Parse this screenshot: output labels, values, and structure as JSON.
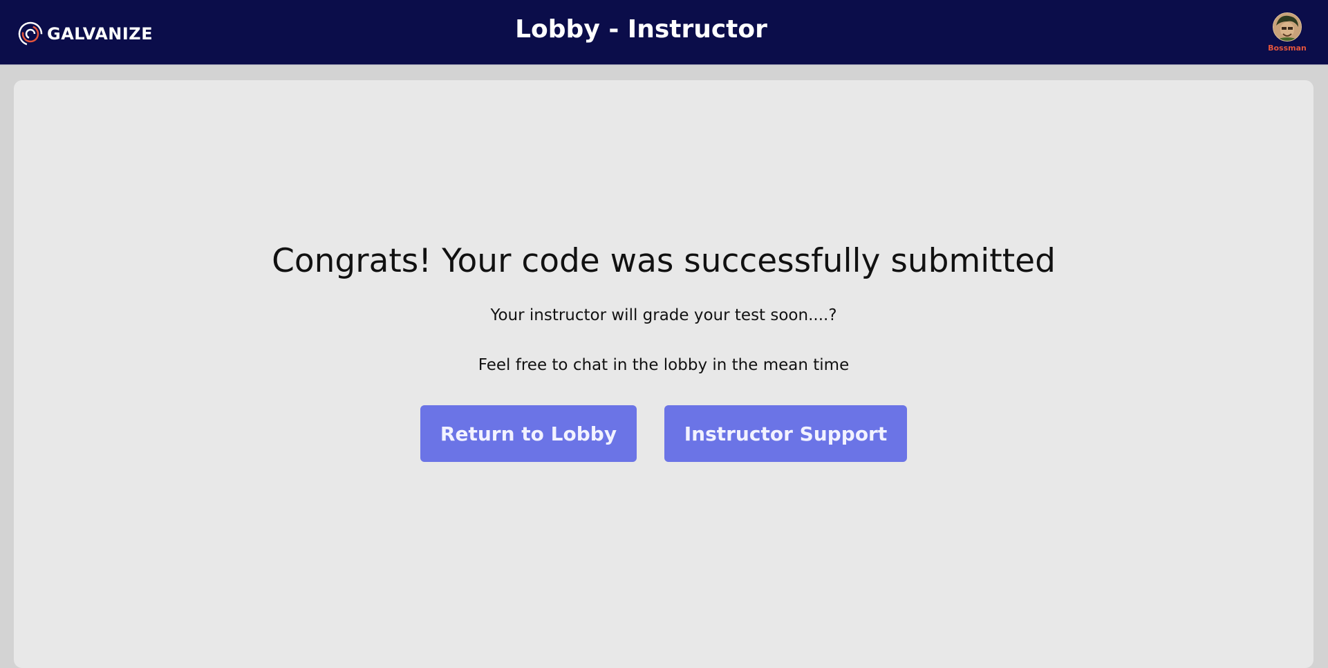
{
  "header": {
    "brand": "GALVANIZE",
    "title": "Lobby - Instructor",
    "user_name": "Bossman",
    "logo_colors": {
      "outer": "#e5553c",
      "inner": "#ffffff"
    }
  },
  "main": {
    "headline": "Congrats! Your code was successfully submitted",
    "message_line1": "Your instructor will grade your test soon....?",
    "message_line2": "Feel free to chat in the lobby in the mean time",
    "buttons": {
      "return_label": "Return to Lobby",
      "support_label": "Instructor Support"
    }
  },
  "colors": {
    "header_bg": "#0b0d4a",
    "page_bg": "#d3d3d3",
    "card_bg": "#e8e8e8",
    "button_bg": "#6b74e6",
    "user_name": "#e5553c"
  }
}
